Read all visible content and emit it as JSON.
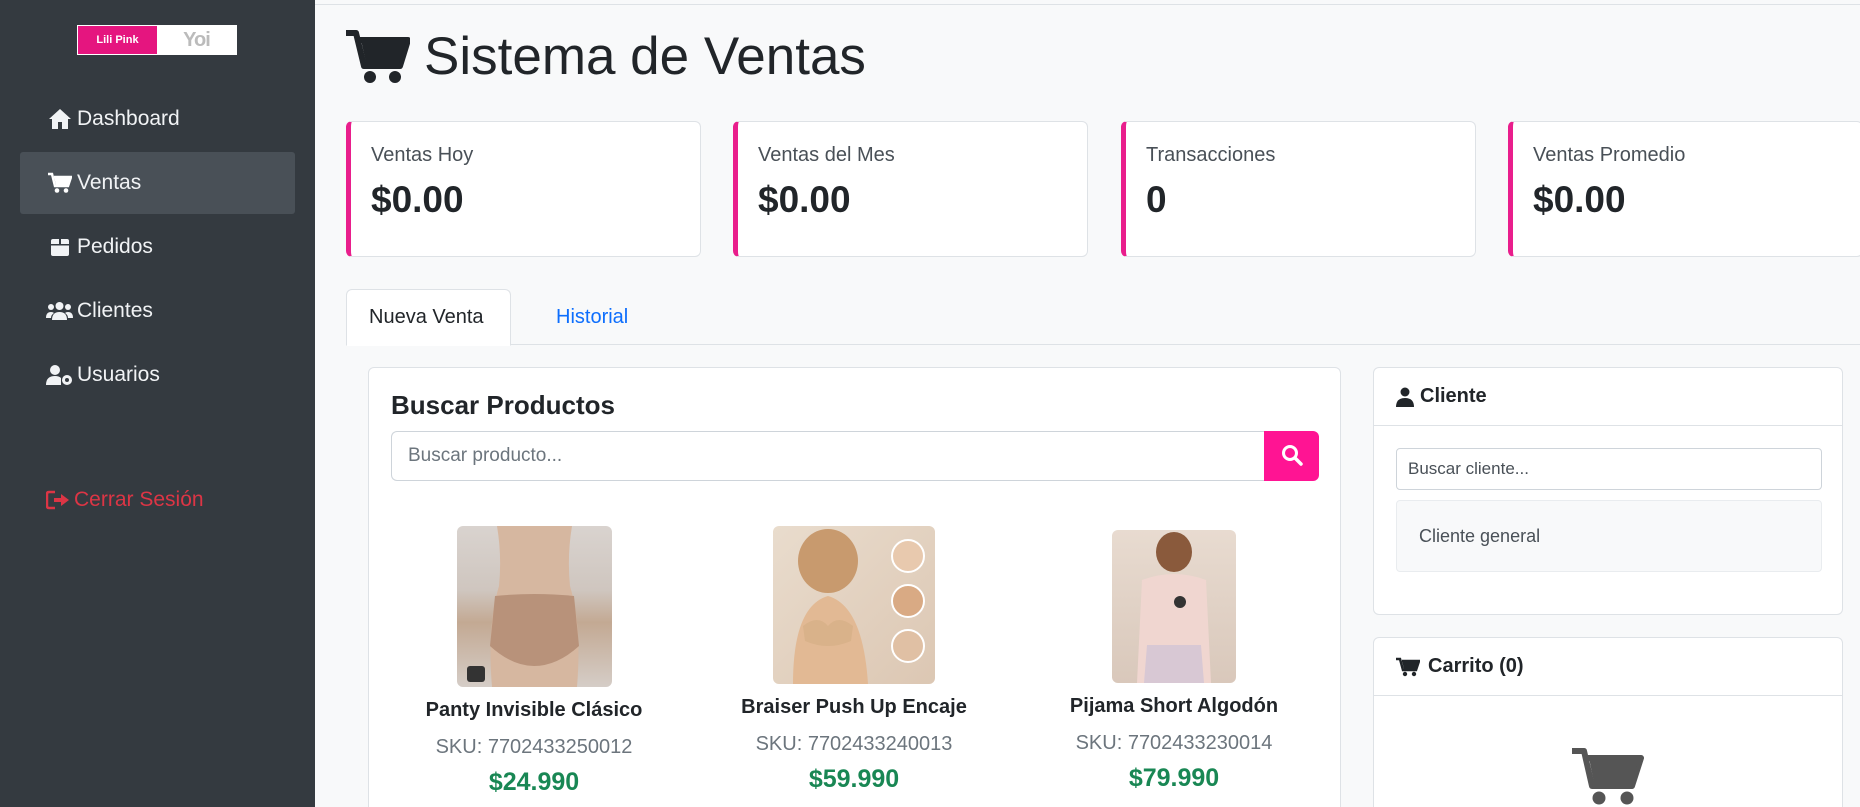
{
  "brand": {
    "left": "Lili Pink",
    "right": "Yoi"
  },
  "sidebar": {
    "items": [
      {
        "label": "Dashboard",
        "icon": "home-icon"
      },
      {
        "label": "Ventas",
        "icon": "cart-icon"
      },
      {
        "label": "Pedidos",
        "icon": "box-icon"
      },
      {
        "label": "Clientes",
        "icon": "users-icon"
      },
      {
        "label": "Usuarios",
        "icon": "user-gear-icon"
      }
    ],
    "logout_label": "Cerrar Sesión"
  },
  "header": {
    "title": "Sistema de Ventas"
  },
  "stats": [
    {
      "label": "Ventas Hoy",
      "value": "$0.00"
    },
    {
      "label": "Ventas del Mes",
      "value": "$0.00"
    },
    {
      "label": "Transacciones",
      "value": "0"
    },
    {
      "label": "Ventas Promedio",
      "value": "$0.00"
    }
  ],
  "tabs": [
    {
      "label": "Nueva Venta"
    },
    {
      "label": "Historial"
    }
  ],
  "search": {
    "title": "Buscar Productos",
    "placeholder": "Buscar producto..."
  },
  "products": [
    {
      "name": "Panty Invisible Clásico",
      "sku": "SKU: 7702433250012",
      "price": "$24.990"
    },
    {
      "name": "Braiser Push Up Encaje",
      "sku": "SKU: 7702433240013",
      "price": "$59.990"
    },
    {
      "name": "Pijama Short Algodón",
      "sku": "SKU: 7702433230014",
      "price": "$79.990"
    }
  ],
  "client": {
    "title": "Cliente",
    "search_placeholder": "Buscar cliente...",
    "default": "Cliente general"
  },
  "cart": {
    "title": "Carrito (0)"
  },
  "colors": {
    "accent": "#e91e8c",
    "sidebar": "#343a40",
    "price": "#198754",
    "link": "#0d6efd",
    "danger": "#dc3545"
  }
}
